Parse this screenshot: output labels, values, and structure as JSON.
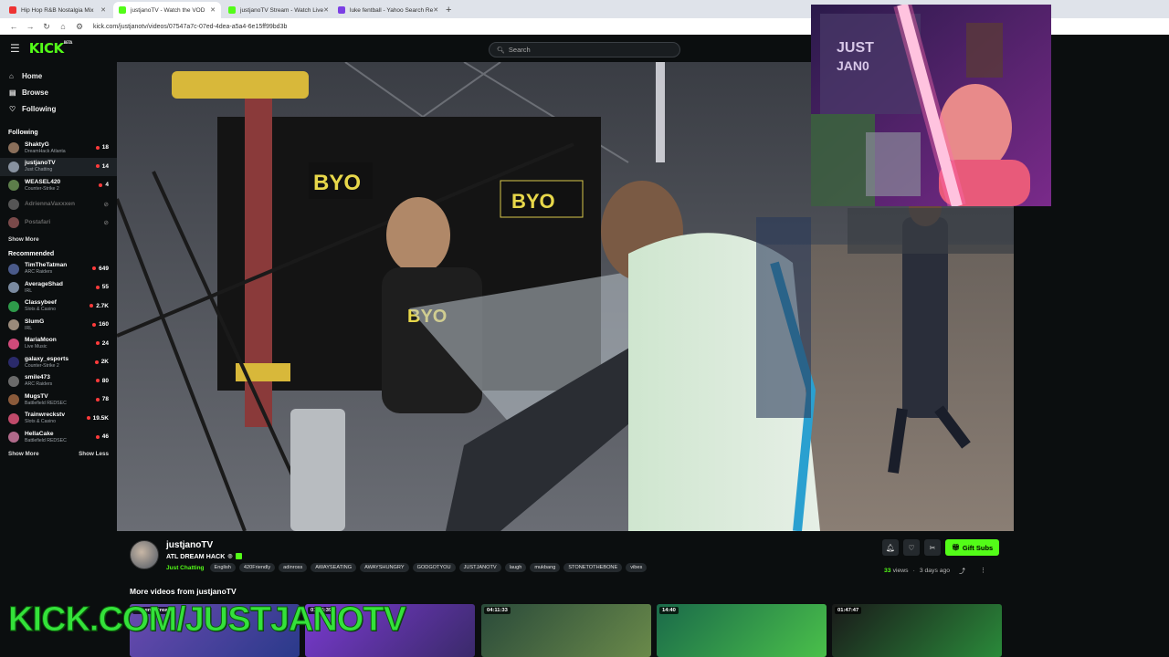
{
  "browser": {
    "tabs": [
      {
        "label": "Hip Hop R&B Nostalgia Mix",
        "color": "#e33",
        "active": false
      },
      {
        "label": "justjanoTV - Watch the VOD",
        "color": "#53fc18",
        "active": true
      },
      {
        "label": "justjanoTV Stream - Watch Live",
        "color": "#53fc18",
        "active": false
      },
      {
        "label": "luke fentball - Yahoo Search Re",
        "color": "#7b3fe4",
        "active": false
      }
    ],
    "new_tab": "+",
    "url": "kick.com/justjanotv/videos/07547a7c-07ed-4dea-a5a4-6e15ff99bd3b"
  },
  "header": {
    "logo": "KICK",
    "beta": "BETA",
    "search_placeholder": "Search"
  },
  "sidebar": {
    "nav": [
      {
        "label": "Home",
        "icon": "home-icon"
      },
      {
        "label": "Browse",
        "icon": "browse-icon"
      },
      {
        "label": "Following",
        "icon": "heart-icon"
      }
    ],
    "following_title": "Following",
    "following": [
      {
        "name": "ShaktyG",
        "sub": "DreamHack Atlanta",
        "count": "18",
        "color": "#8a6f5a"
      },
      {
        "name": "justjanoTV",
        "sub": "Just Chatting",
        "count": "14",
        "color": "#8892a0",
        "active": true
      },
      {
        "name": "WEASEL420",
        "sub": "Counter-Strike 2",
        "count": "4",
        "color": "#5c7d4a"
      },
      {
        "name": "AdriennaVaxxxen",
        "sub": "",
        "count": "",
        "color": "#555",
        "offline": true
      },
      {
        "name": "Postafari",
        "sub": "",
        "count": "",
        "color": "#7a4a4a",
        "offline": true
      }
    ],
    "show_more": "Show More",
    "recommended_title": "Recommended",
    "recommended": [
      {
        "name": "TimTheTatman",
        "sub": "ARC Raiders",
        "count": "649",
        "color": "#4a5a8a"
      },
      {
        "name": "AverageShad",
        "sub": "IRL",
        "count": "55",
        "color": "#7a8aa0"
      },
      {
        "name": "Classybeef",
        "sub": "Slots & Casino",
        "count": "2.7K",
        "color": "#2e9a4a"
      },
      {
        "name": "SlumG",
        "sub": "IRL",
        "count": "160",
        "color": "#9a8a7a"
      },
      {
        "name": "MariaMoon",
        "sub": "Live Music",
        "count": "24",
        "color": "#d04a7a"
      },
      {
        "name": "galaxy_esports",
        "sub": "Counter-Strike 2",
        "count": "2K",
        "color": "#2a2a6a"
      },
      {
        "name": "smile473",
        "sub": "ARC Raiders",
        "count": "80",
        "color": "#6a6a6a"
      },
      {
        "name": "MugsTV",
        "sub": "Battlefield REDSEC",
        "count": "78",
        "color": "#8a5a3a"
      },
      {
        "name": "Trainwreckstv",
        "sub": "Slots & Casino",
        "count": "19.5K",
        "color": "#c04a6a"
      },
      {
        "name": "HellaCake",
        "sub": "Battlefield REDSEC",
        "count": "46",
        "color": "#b06a8a"
      }
    ],
    "show_more_2": "Show More",
    "show_less": "Show Less"
  },
  "video_info": {
    "channel": "justjanoTV",
    "title": "ATL DREAM HACK",
    "category": "Just Chatting",
    "tags": [
      "English",
      "420Friendly",
      "adinross",
      "AWAYSEATING",
      "AWAYSHUNGRY",
      "GODGOTYOU",
      "JUSTJANOTV",
      "laugh",
      "mukbang",
      "STONETOTHEBONE",
      "vibes"
    ],
    "gift_label": "Gift Subs",
    "views_count": "33",
    "views_label": "views",
    "age": "3 days ago",
    "more_videos_title": "More videos from justjanoTV"
  },
  "thumbnails": [
    {
      "duration": "Recent Stream",
      "colors": [
        "#6a4ab0",
        "#2a3a8a"
      ]
    },
    {
      "duration": "01:45:39",
      "colors": [
        "#7a3ad0",
        "#3a2a6a"
      ]
    },
    {
      "duration": "04:11:33",
      "colors": [
        "#2a4a3a",
        "#6a8a4a"
      ]
    },
    {
      "duration": "14:40",
      "colors": [
        "#1a6a4a",
        "#4ac04a"
      ]
    },
    {
      "duration": "01:47:47",
      "colors": [
        "#1a1a1a",
        "#2a8a3a"
      ]
    }
  ],
  "watermark": "KICK.COM/JUSTJANOTV"
}
